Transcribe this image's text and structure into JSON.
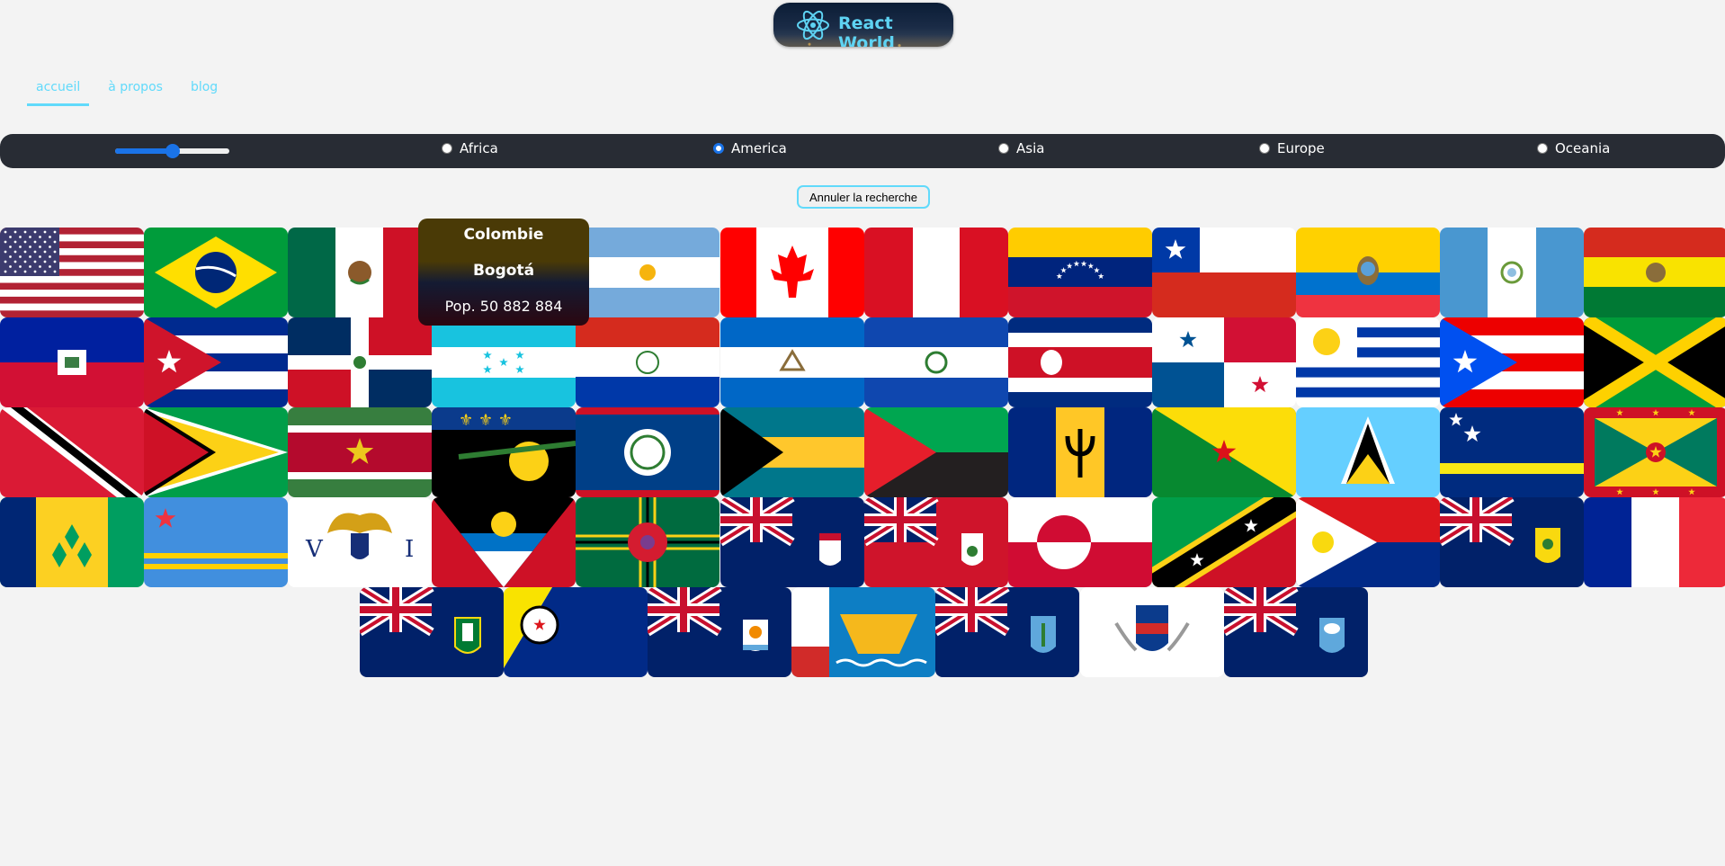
{
  "header": {
    "logo_text": "React World"
  },
  "nav": {
    "items": [
      {
        "label": "accueil",
        "active": true
      },
      {
        "label": "à propos",
        "active": false
      },
      {
        "label": "blog",
        "active": false
      }
    ]
  },
  "filter": {
    "range_value": 0.5,
    "regions": [
      {
        "label": "Africa",
        "checked": false
      },
      {
        "label": "America",
        "checked": true
      },
      {
        "label": "Asia",
        "checked": false
      },
      {
        "label": "Europe",
        "checked": false
      },
      {
        "label": "Oceania",
        "checked": false
      }
    ],
    "cancel_label": "Annuler la recherche"
  },
  "tooltip": {
    "name": "Colombie",
    "capital": "Bogotá",
    "population": "Pop. 50 882 884"
  },
  "colors": {
    "accent": "#61dafb",
    "bar": "#282c34",
    "radio": "#1a73e8"
  },
  "flags": [
    {
      "name": "united-states"
    },
    {
      "name": "brazil"
    },
    {
      "name": "mexico"
    },
    {
      "name": "colombia"
    },
    {
      "name": "argentina"
    },
    {
      "name": "canada"
    },
    {
      "name": "peru"
    },
    {
      "name": "venezuela"
    },
    {
      "name": "chile"
    },
    {
      "name": "ecuador"
    },
    {
      "name": "guatemala"
    },
    {
      "name": "bolivia"
    },
    {
      "name": "haiti"
    },
    {
      "name": "cuba"
    },
    {
      "name": "dominican-republic"
    },
    {
      "name": "honduras"
    },
    {
      "name": "paraguay"
    },
    {
      "name": "nicaragua"
    },
    {
      "name": "el-salvador"
    },
    {
      "name": "costa-rica"
    },
    {
      "name": "panama"
    },
    {
      "name": "uruguay"
    },
    {
      "name": "puerto-rico"
    },
    {
      "name": "jamaica"
    },
    {
      "name": "trinidad-and-tobago"
    },
    {
      "name": "guyana"
    },
    {
      "name": "suriname"
    },
    {
      "name": "guadeloupe"
    },
    {
      "name": "belize"
    },
    {
      "name": "bahamas"
    },
    {
      "name": "martinique"
    },
    {
      "name": "barbados"
    },
    {
      "name": "french-guiana"
    },
    {
      "name": "saint-lucia"
    },
    {
      "name": "curacao"
    },
    {
      "name": "grenada"
    },
    {
      "name": "saint-vincent"
    },
    {
      "name": "aruba"
    },
    {
      "name": "us-virgin-islands"
    },
    {
      "name": "antigua"
    },
    {
      "name": "dominica"
    },
    {
      "name": "cayman-islands"
    },
    {
      "name": "bermuda"
    },
    {
      "name": "greenland"
    },
    {
      "name": "saint-kitts"
    },
    {
      "name": "sint-maarten"
    },
    {
      "name": "turks-caicos"
    },
    {
      "name": "saint-martin"
    },
    {
      "name": "british-virgin-islands"
    },
    {
      "name": "bonaire"
    },
    {
      "name": "anguilla"
    },
    {
      "name": "saint-pierre-miquelon"
    },
    {
      "name": "montserrat"
    },
    {
      "name": "saint-barthelemy"
    },
    {
      "name": "falkland-islands"
    }
  ]
}
